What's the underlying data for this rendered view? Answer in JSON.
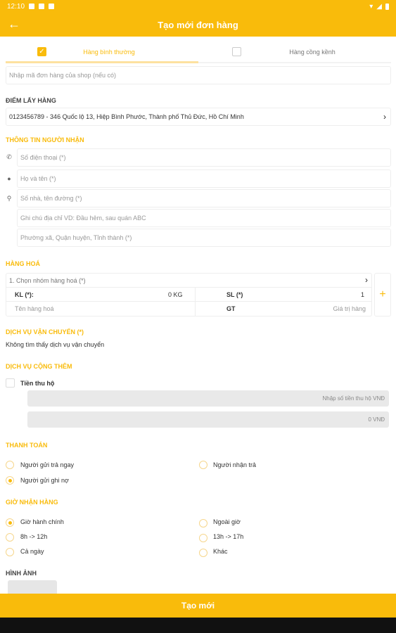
{
  "status_bar": {
    "time": "12:10"
  },
  "app_bar": {
    "title": "Tạo mới đơn hàng"
  },
  "tabs": [
    {
      "label": "Hàng bình thường",
      "checked": true
    },
    {
      "label": "Hàng cồng kềnh",
      "checked": false
    }
  ],
  "order_code": {
    "placeholder": "Nhập mã đơn hàng của shop (nếu có)"
  },
  "pickup": {
    "title": "ĐIỂM LẤY HÀNG",
    "value": "0123456789 - 346 Quốc lộ 13, Hiệp Bình Phước, Thành phố Thủ Đức, Hồ Chí Minh"
  },
  "receiver": {
    "title": "THÔNG TIN NGƯỜI NHẬN",
    "phone_placeholder": "Số điện thoại (*)",
    "name_placeholder": "Họ và tên (*)",
    "address_placeholder": "Số nhà, tên đường (*)",
    "note_placeholder": "Ghi chú địa chỉ VD: Đầu hẻm, sau quán ABC",
    "area_placeholder": "Phường xã, Quận huyện, Tỉnh thành (*)"
  },
  "goods": {
    "title": "HÀNG HOÁ",
    "group_placeholder": "1. Chọn nhóm hàng hoá (*)",
    "weight_label": "KL (*):",
    "weight_value": "0 KG",
    "qty_label": "SL (*)",
    "qty_value": "1",
    "name_placeholder": "Tên hàng hoá",
    "value_label": "GT",
    "value_placeholder": "Giá trị hàng"
  },
  "shipping": {
    "title": "DỊCH VỤ VẬN CHUYỂN (*)",
    "empty_text": "Không tìm thấy dịch vụ vận chuyển"
  },
  "extra": {
    "title": "DỊCH VỤ CỘNG THÊM",
    "cod_label": "Tiền thu hộ",
    "cod_placeholder": "Nhập số tiền thu hộ VNĐ",
    "cod_value": "0 VNĐ"
  },
  "payment": {
    "title": "THANH TOÁN",
    "options": [
      "Người gửi trả ngay",
      "Người nhận trả",
      "Người gửi ghi nợ"
    ],
    "selected": "Người gửi ghi nợ"
  },
  "receive_time": {
    "title": "GIỜ NHẬN HÀNG",
    "options": [
      "Giờ hành chính",
      "Ngoài giờ",
      "8h -> 12h",
      "13h -> 17h",
      "Cả ngày",
      "Khác"
    ],
    "selected": "Giờ hành chính"
  },
  "images": {
    "title": "HÌNH ẢNH"
  },
  "submit": {
    "label": "Tạo mới"
  },
  "colors": {
    "accent": "#f9bb0b"
  }
}
